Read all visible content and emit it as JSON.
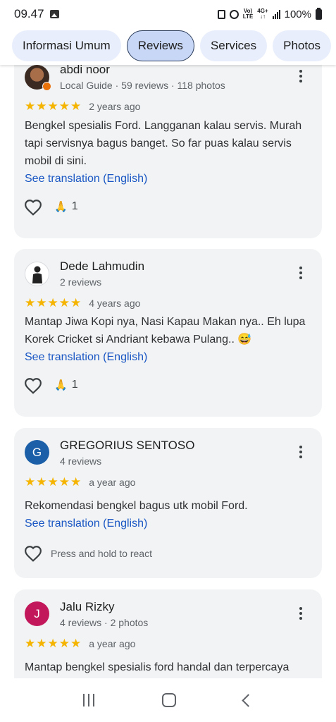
{
  "status_bar": {
    "time": "09.47",
    "network_top": "Vo)",
    "network_bottom": "LTE",
    "net2_top": "4G+",
    "net2_bottom": "↓↑",
    "battery": "100%"
  },
  "tabs": [
    {
      "label": "Informasi Umum",
      "active": false
    },
    {
      "label": "Reviews",
      "active": true
    },
    {
      "label": "Services",
      "active": false
    },
    {
      "label": "Photos",
      "active": false
    }
  ],
  "reviews": [
    {
      "name": "abdi noor",
      "meta": "Local Guide · 59 reviews · 118 photos",
      "rating": 5,
      "when": "2 years ago",
      "text": "Bengkel spesialis Ford. Langganan kalau servis. Murah tapi servisnya bagus banget. So far puas kalau servis mobil di sini.",
      "translate": "See translation (English)",
      "reaction_emoji": "🙏",
      "reaction_count": "1"
    },
    {
      "name": "Dede Lahmudin",
      "meta": "2 reviews",
      "rating": 5,
      "when": "4 years ago",
      "text": "Mantap Jiwa Kopi nya, Nasi Kapau Makan nya.. Eh lupa Korek Cricket si Andriant kebawa Pulang.. 😅",
      "translate": "See translation (English)",
      "reaction_emoji": "🙏",
      "reaction_count": "1"
    },
    {
      "name": "GREGORIUS SENTOSO",
      "avatar_letter": "G",
      "avatar_color": "#1a5fa8",
      "meta": "4 reviews",
      "rating": 5,
      "when": "a year ago",
      "text": "Rekomendasi bengkel bagus utk mobil Ford.",
      "translate": "See translation (English)",
      "hold_text": "Press and hold to react"
    },
    {
      "name": "Jalu Rizky",
      "avatar_letter": "J",
      "avatar_color": "#c2185b",
      "meta": "4 reviews · 2 photos",
      "rating": 5,
      "when": "a year ago",
      "text": "Mantap bengkel spesialis ford handal dan terpercaya"
    }
  ],
  "colors": {
    "star": "#f5b400",
    "link": "#1a57c4",
    "tab_active": "#c8d7f5",
    "tab": "#e8eefb",
    "card": "#f1f3f4"
  }
}
